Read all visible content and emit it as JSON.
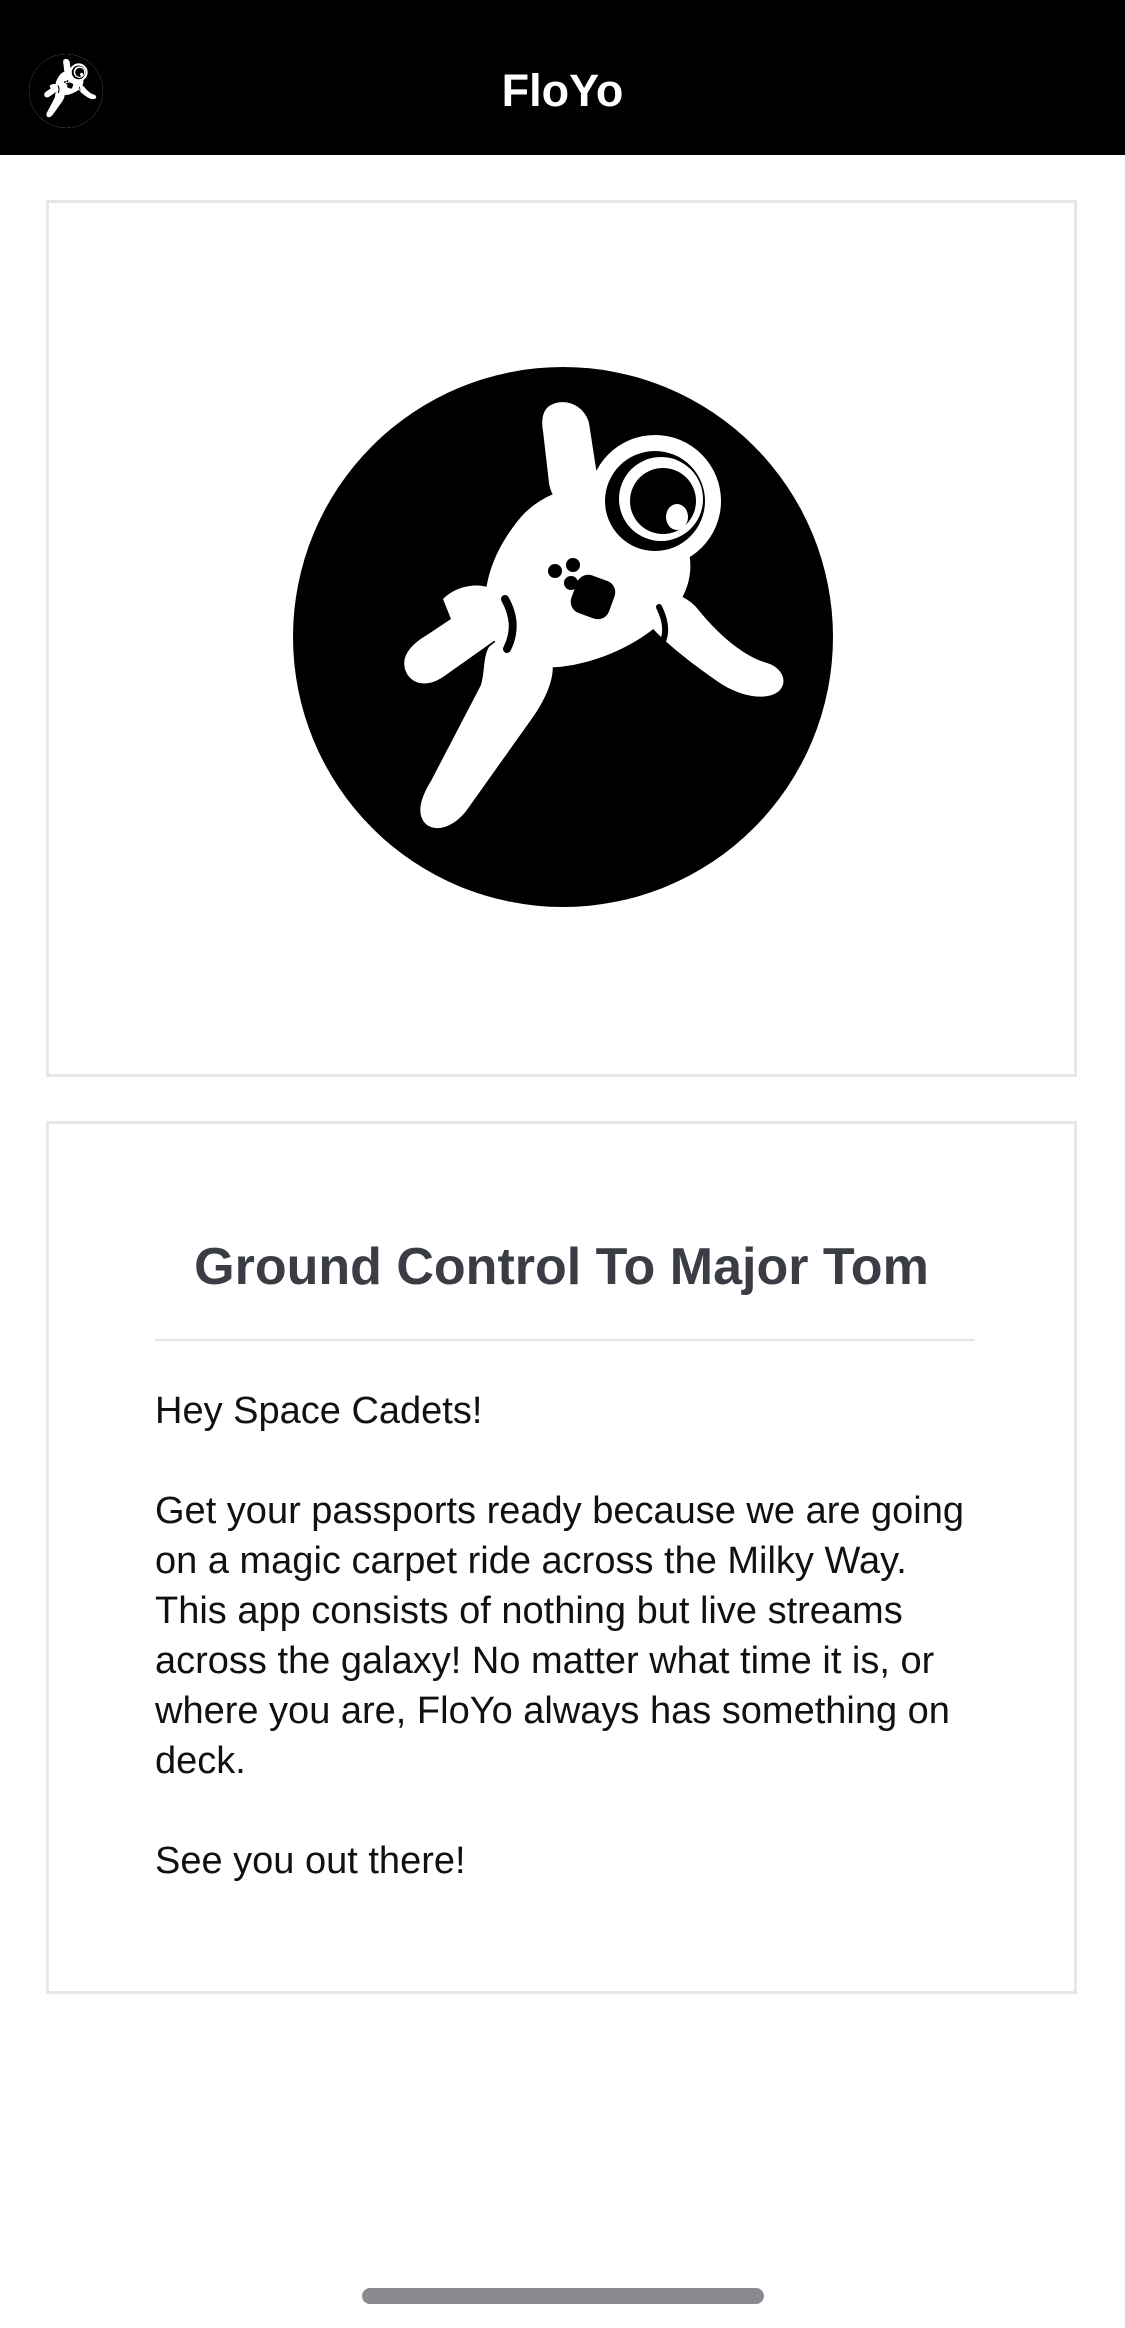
{
  "nav": {
    "title": "FloYo",
    "avatar_icon": "astronaut-icon"
  },
  "hero": {
    "logo_icon": "astronaut-icon"
  },
  "info": {
    "heading": "Ground Control To Major Tom",
    "greeting": "Hey Space Cadets!",
    "body": "Get your passports ready because we are going on a magic carpet ride across the Milky Way. This app consists of nothing but live streams across the galaxy! No matter what time it is, or where you are, FloYo always has something on deck.",
    "signoff": "See you out there!"
  },
  "colors": {
    "nav_background": "#000000",
    "nav_text": "#ffffff",
    "heading_text": "#3a3d44",
    "card_border": "#e6e6eb",
    "home_indicator": "#8a8a8e"
  }
}
